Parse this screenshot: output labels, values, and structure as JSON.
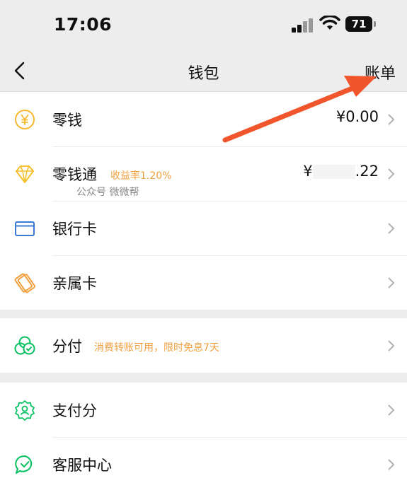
{
  "status_bar": {
    "time": "17:06",
    "battery": "71"
  },
  "nav": {
    "title": "钱包",
    "bill_label": "账单"
  },
  "wallet": {
    "items": [
      {
        "label": "零钱",
        "value": "¥0.00"
      },
      {
        "label": "零钱通",
        "sub": "收益率1.20%",
        "value_prefix": "¥",
        "value_suffix": ".22",
        "watermark": "公众号 微微帮"
      },
      {
        "label": "银行卡"
      },
      {
        "label": "亲属卡"
      }
    ]
  },
  "fenfu": {
    "label": "分付",
    "sub": "消费转账可用，限时免息7天"
  },
  "services": {
    "items": [
      {
        "label": "支付分"
      },
      {
        "label": "客服中心"
      }
    ]
  },
  "colors": {
    "accent_orange": "#f0a040",
    "wechat_green": "#07c160",
    "bank_blue": "#3a7bd5",
    "arrow_red": "#f0552b"
  },
  "icons": [
    "chevron-left-icon",
    "yen-coin-icon",
    "diamond-icon",
    "bank-card-icon",
    "family-card-icon",
    "fenfu-icon",
    "pay-score-icon",
    "customer-service-icon",
    "chevron-right-icon"
  ]
}
